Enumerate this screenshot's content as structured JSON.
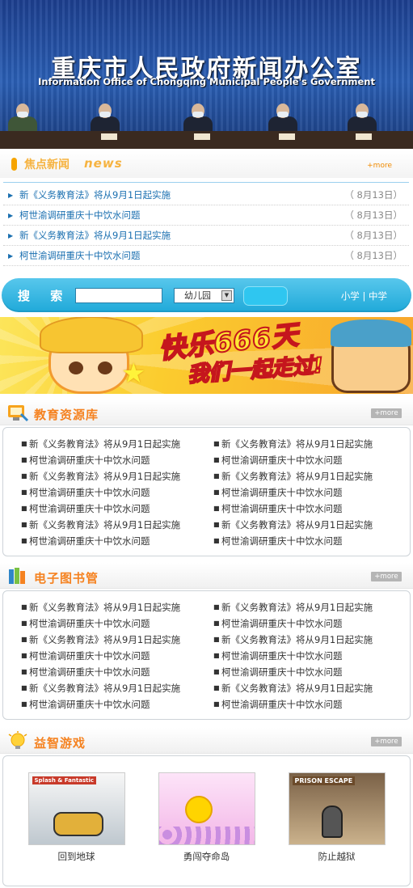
{
  "header": {
    "title_cn": "重庆市人民政府新闻办公室",
    "title_en": "Information Office of Chongqing Municipal People's Government"
  },
  "news": {
    "title_cn": "焦点新闻",
    "title_en": "news",
    "more": "+more",
    "items": [
      {
        "text": "新《义务教育法》将从9月1日起实施",
        "date": "（ 8月13日）"
      },
      {
        "text": "柯世渝调研重庆十中饮水问题",
        "date": "（ 8月13日）"
      },
      {
        "text": "新《义务教育法》将从9月1日起实施",
        "date": "（ 8月13日）"
      },
      {
        "text": "柯世渝调研重庆十中饮水问题",
        "date": "（ 8月13日）"
      }
    ]
  },
  "search": {
    "label": "搜 索",
    "input_value": "",
    "select_value": "幼儿园",
    "links": "小学 | 中学"
  },
  "banner": {
    "slogan1": "快乐666天",
    "slogan2": "我们一起走过!"
  },
  "edu": {
    "title": "教育资源库",
    "more": "+more",
    "left": [
      "新《义务教育法》将从9月1日起实施",
      "柯世渝调研重庆十中饮水问题",
      "新《义务教育法》将从9月1日起实施",
      "柯世渝调研重庆十中饮水问题",
      "柯世渝调研重庆十中饮水问题",
      "新《义务教育法》将从9月1日起实施",
      "柯世渝调研重庆十中饮水问题"
    ],
    "right": [
      "新《义务教育法》将从9月1日起实施",
      "柯世渝调研重庆十中饮水问题",
      "新《义务教育法》将从9月1日起实施",
      "柯世渝调研重庆十中饮水问题",
      "柯世渝调研重庆十中饮水问题",
      "新《义务教育法》将从9月1日起实施",
      "柯世渝调研重庆十中饮水问题"
    ]
  },
  "library": {
    "title": "电子图书管",
    "more": "+more",
    "left": [
      "新《义务教育法》将从9月1日起实施",
      "柯世渝调研重庆十中饮水问题",
      "新《义务教育法》将从9月1日起实施",
      "柯世渝调研重庆十中饮水问题",
      "柯世渝调研重庆十中饮水问题",
      "新《义务教育法》将从9月1日起实施",
      "柯世渝调研重庆十中饮水问题"
    ],
    "right": [
      "新《义务教育法》将从9月1日起实施",
      "柯世渝调研重庆十中饮水问题",
      "新《义务教育法》将从9月1日起实施",
      "柯世渝调研重庆十中饮水问题",
      "柯世渝调研重庆十中饮水问题",
      "新《义务教育法》将从9月1日起实施",
      "柯世渝调研重庆十中饮水问题"
    ]
  },
  "games": {
    "title": "益智游戏",
    "more": "+more",
    "items": [
      {
        "name": "回到地球",
        "thumb_title": "Splash & Fantastic",
        "color": "#c83a2a"
      },
      {
        "name": "勇闯夺命岛",
        "thumb_title": "",
        "color": "#f3b7e8"
      },
      {
        "name": "防止越狱",
        "thumb_title": "PRISON ESCAPE",
        "color": "#a28a6b"
      }
    ]
  },
  "colors": {
    "accent_orange": "#f58220",
    "search_blue": "#1fa9d9",
    "link_blue": "#1a6fb0"
  }
}
